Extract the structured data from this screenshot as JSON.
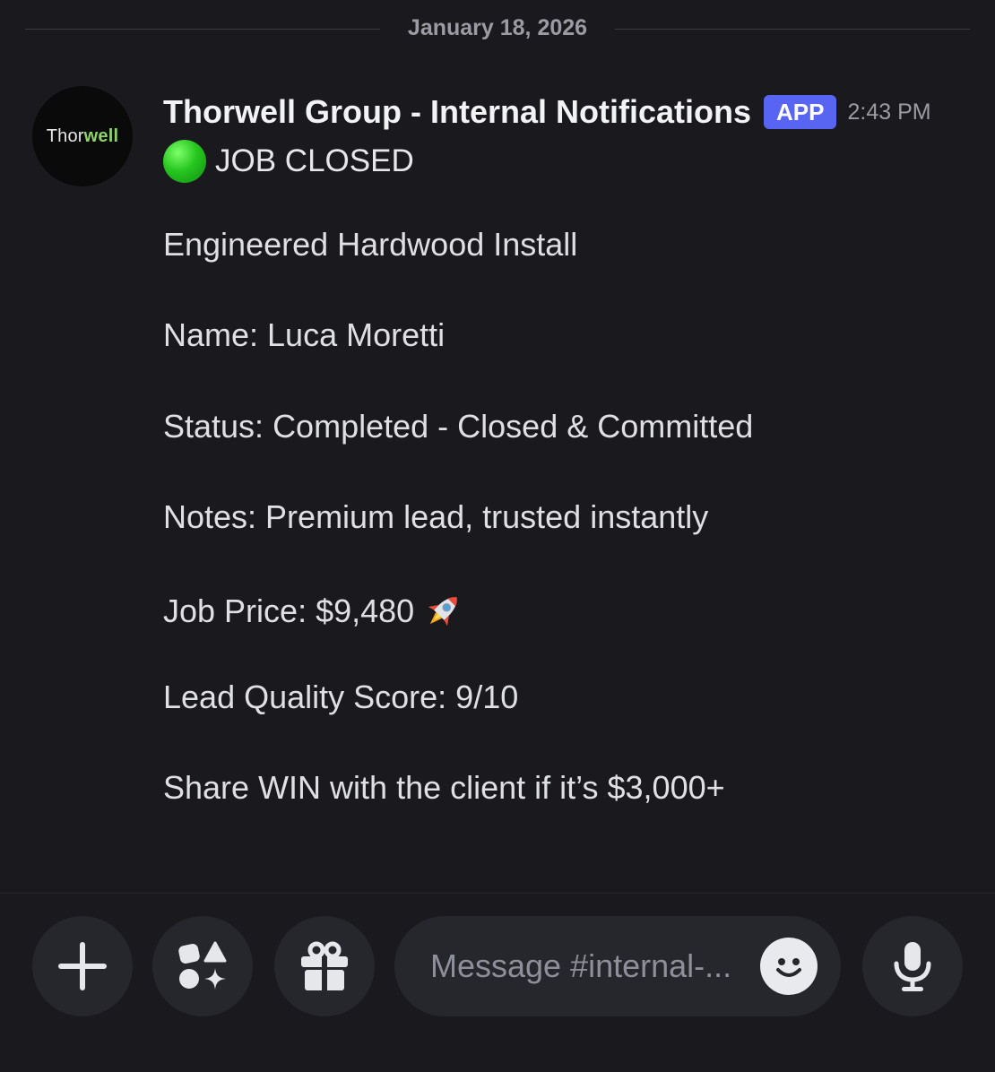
{
  "date_divider": "January 18, 2026",
  "avatar": {
    "text_left": "Thor",
    "text_right": "well"
  },
  "message": {
    "author": "Thorwell Group - Internal Notifications",
    "badge": "APP",
    "time": "2:43 PM",
    "status_emoji": "green-circle",
    "title": "JOB CLOSED",
    "lines": [
      "Engineered Hardwood Install",
      "Name: Luca Moretti",
      "Status: Completed - Closed & Committed",
      "Notes: Premium lead, trusted instantly",
      "Job Price: $9,480",
      "Lead Quality Score: 9/10",
      "Share WIN with the client if it’s $3,000+"
    ],
    "price_emoji": "rocket"
  },
  "composer": {
    "placeholder": "Message #internal-...",
    "buttons": [
      "plus-icon",
      "apps-icon",
      "gift-icon",
      "emoji-icon",
      "microphone-icon"
    ]
  },
  "colors": {
    "badge": "#5865f2",
    "background": "#1a1a1e",
    "button_bg": "#26272c"
  }
}
